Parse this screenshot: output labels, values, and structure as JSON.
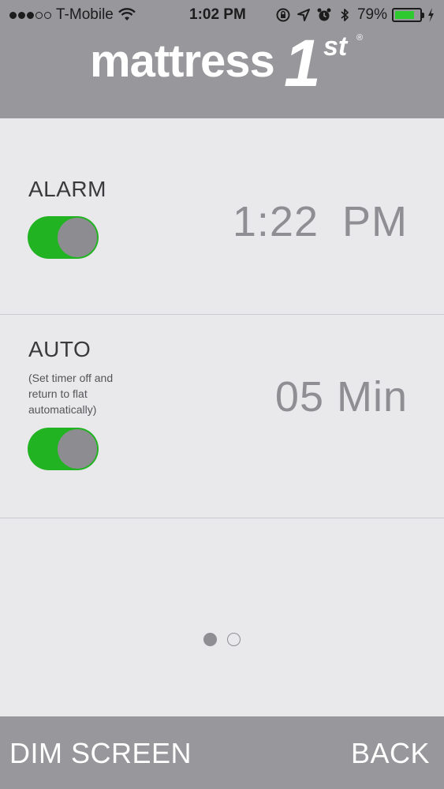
{
  "status_bar": {
    "carrier": "T-Mobile",
    "time": "1:02 PM",
    "battery": "79%",
    "battery_level": 0.79,
    "icons": [
      "signal-dots",
      "wifi-icon",
      "orientation-lock-icon",
      "location-icon",
      "alarm-icon",
      "bluetooth-icon",
      "battery-icon",
      "charging-icon"
    ]
  },
  "header": {
    "logo_word": "mattress",
    "logo_one": "1",
    "logo_st": "st",
    "logo_reg": "®"
  },
  "alarm": {
    "label": "ALARM",
    "time": "1:22",
    "ampm": "PM",
    "toggle_on": true
  },
  "auto": {
    "label": "AUTO",
    "note": "(Set timer off and return to flat automatically)",
    "value": "05 Min",
    "toggle_on": true
  },
  "pagination": {
    "current_page": 1,
    "total_pages": 2
  },
  "footer": {
    "dim_label": "DIM SCREEN",
    "back_label": "BACK"
  },
  "colors": {
    "header_bg": "#98989c",
    "content_bg": "#e9e9ec",
    "toggle_on": "#22b322",
    "value_text": "#8e8e93"
  }
}
